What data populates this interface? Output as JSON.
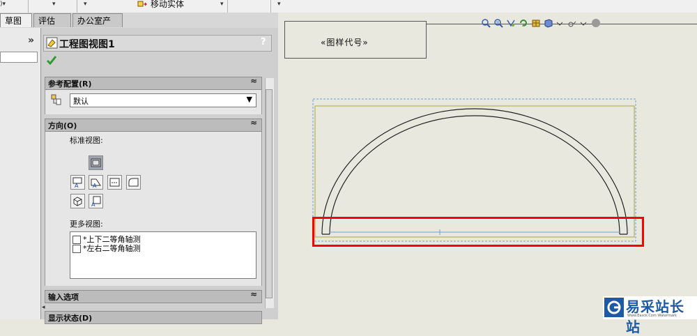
{
  "toolbar": {
    "move_body_label": "移动实体"
  },
  "tabs": [
    {
      "label": "草图",
      "active": true
    },
    {
      "label": "评估",
      "active": false
    },
    {
      "label": "办公室产品",
      "active": false
    }
  ],
  "tree": {
    "collapse_glyph": "»"
  },
  "property_manager": {
    "title": "工程图视图1",
    "help_glyph": "?",
    "groups": {
      "reference_config": {
        "title": "参考配置(R)",
        "collapse_glyph": "≈",
        "selected_value": "默认"
      },
      "orientation": {
        "title": "方向(O)",
        "collapse_glyph": "≈",
        "standard_views_label": "标准视图:",
        "more_views_label": "更多视图:",
        "more_views": [
          "*上下二等角轴测",
          "*左右二等角轴测"
        ]
      },
      "import_options": {
        "title": "输入选项",
        "collapse_glyph": "≈"
      },
      "display_state": {
        "title": "显示状态(D)"
      }
    }
  },
  "canvas": {
    "title_block_text": "«图样代号»"
  },
  "watermark": {
    "text": "易采站长站",
    "sub": "Www.Easck.Com Watermark"
  },
  "colors": {
    "highlight_box": "#ff0000",
    "canvas_bg": "#e8e8de",
    "view_boundary": "#6ea0d8",
    "sheet_line": "#a9a93c"
  }
}
